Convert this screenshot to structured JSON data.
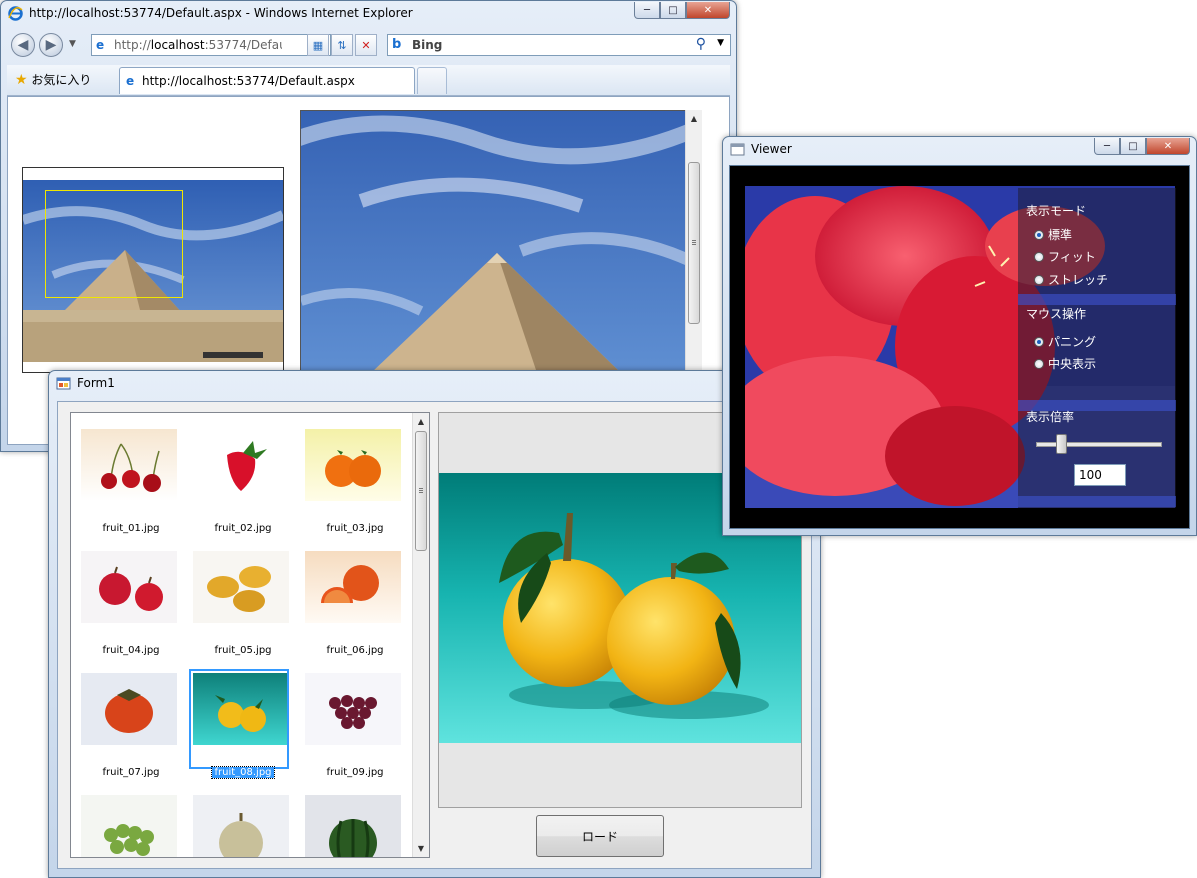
{
  "ie": {
    "window_title": "http://localhost:53774/Default.aspx - Windows Internet Explorer",
    "address_prefix": "http://",
    "address_host": "localhost",
    "address_rest": ":53774/Defau",
    "search_label": "Bing",
    "favorites_label": "お気に入り",
    "tab_title": "http://localhost:53774/Default.aspx"
  },
  "form1": {
    "window_title": "Form1",
    "items": [
      {
        "label": "fruit_01.jpg"
      },
      {
        "label": "fruit_02.jpg"
      },
      {
        "label": "fruit_03.jpg"
      },
      {
        "label": "fruit_04.jpg"
      },
      {
        "label": "fruit_05.jpg"
      },
      {
        "label": "fruit_06.jpg"
      },
      {
        "label": "fruit_07.jpg"
      },
      {
        "label": "fruit_08.jpg"
      },
      {
        "label": "fruit_09.jpg"
      }
    ],
    "selected_item": "fruit_08.jpg",
    "load_button": "ロード"
  },
  "viewer": {
    "window_title": "Viewer",
    "display_mode_header": "表示モード",
    "display_modes": [
      "標準",
      "フィット",
      "ストレッチ"
    ],
    "selected_display_mode": "標準",
    "mouse_header": "マウス操作",
    "mouse_modes": [
      "パニング",
      "中央表示"
    ],
    "selected_mouse_mode": "パニング",
    "zoom_header": "表示倍率",
    "zoom_value": "100",
    "zoom_slider_fraction": 0.2
  }
}
